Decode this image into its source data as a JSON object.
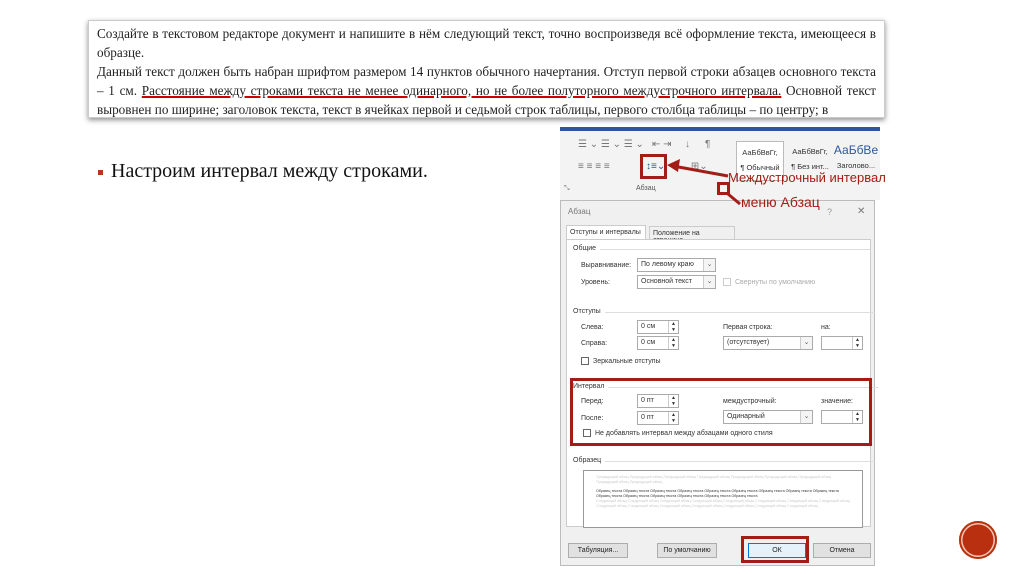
{
  "task_text": {
    "p1": "Создайте в текстовом редакторе документ и напишите в нём следующий текст, точно воспроизведя всё оформление текста, имеющееся в образце.",
    "p2_start": "Данный текст должен быть набран шрифтом размером 14 пунктов обычного начертания. Отступ первой строки абзацев основного текста – 1 см. ",
    "p2_underlined": "Расстояние между строками текста не менее одинарного, но не более полуторного междустрочного интервала.",
    "p2_end": " Основной текст выровнен по ширине; заголовок текста, текст в ячейках первой и седьмой строк таблицы, первого столбца таблицы – по центру; в"
  },
  "bullet": "Настроим интервал между строками.",
  "ribbon": {
    "group_label": "Абзац",
    "styles": [
      {
        "preview": "АаБбВвГг,",
        "name": "¶ Обычный"
      },
      {
        "preview": "АаБбВвГг,",
        "name": "¶ Без инт..."
      },
      {
        "preview": "АаБбВе",
        "name": "Заголово..."
      }
    ]
  },
  "annotations": {
    "line_spacing": "Междустрочный интервал",
    "paragraph_menu": "меню Абзац",
    "color": "#a31d16"
  },
  "dialog": {
    "title": "Абзац",
    "help": "?",
    "close": "✕",
    "tabs": [
      "Отступы и интервалы",
      "Положение на странице"
    ],
    "general": {
      "section": "Общие",
      "alignment_label": "Выравнивание:",
      "alignment_value": "По левому краю",
      "level_label": "Уровень:",
      "level_value": "Основной текст",
      "collapsed_label": "Свернуты по умолчанию"
    },
    "indents": {
      "section": "Отступы",
      "left_label": "Слева:",
      "left_value": "0 см",
      "right_label": "Справа:",
      "right_value": "0 см",
      "first_line_label": "Первая строка:",
      "first_line_value": "(отсутствует)",
      "by_label": "на:",
      "mirror_label": "Зеркальные отступы"
    },
    "spacing": {
      "section": "Интервал",
      "before_label": "Перед:",
      "before_value": "0 пт",
      "after_label": "После:",
      "after_value": "0 пт",
      "line_spacing_label": "междустрочный:",
      "line_spacing_value": "Одинарный",
      "at_label": "значение:",
      "no_space_label": "Не добавлять интервал между абзацами одного стиля"
    },
    "preview": {
      "section": "Образец",
      "prev": "Предыдущий абзац Предыдущий абзац Предыдущий абзац Предыдущий абзац Предыдущий абзац Предыдущий абзац Предыдущий абзац Предыдущий абзац Предыдущий абзац",
      "sample": "Образец текста Образец текста Образец текста Образец текста Образец текста Образец текста Образец текста Образец текста Образец текста Образец текста Образец текста Образец текста Образец текста Образец текста Образец текста",
      "next": "Следующий абзац Следующий абзац Следующий абзац Следующий абзац Следующий абзац Следующий абзац Следующий абзац Следующий абзац Следующий абзац Следующий абзац Следующий абзац Следующий абзац Следующий абзац Следующий абзац Следующий абзац"
    },
    "buttons": {
      "tabs": "Табуляция...",
      "default": "По умолчанию",
      "ok": "ОК",
      "cancel": "Отмена"
    }
  },
  "nav_circle_color": "#b8300f"
}
